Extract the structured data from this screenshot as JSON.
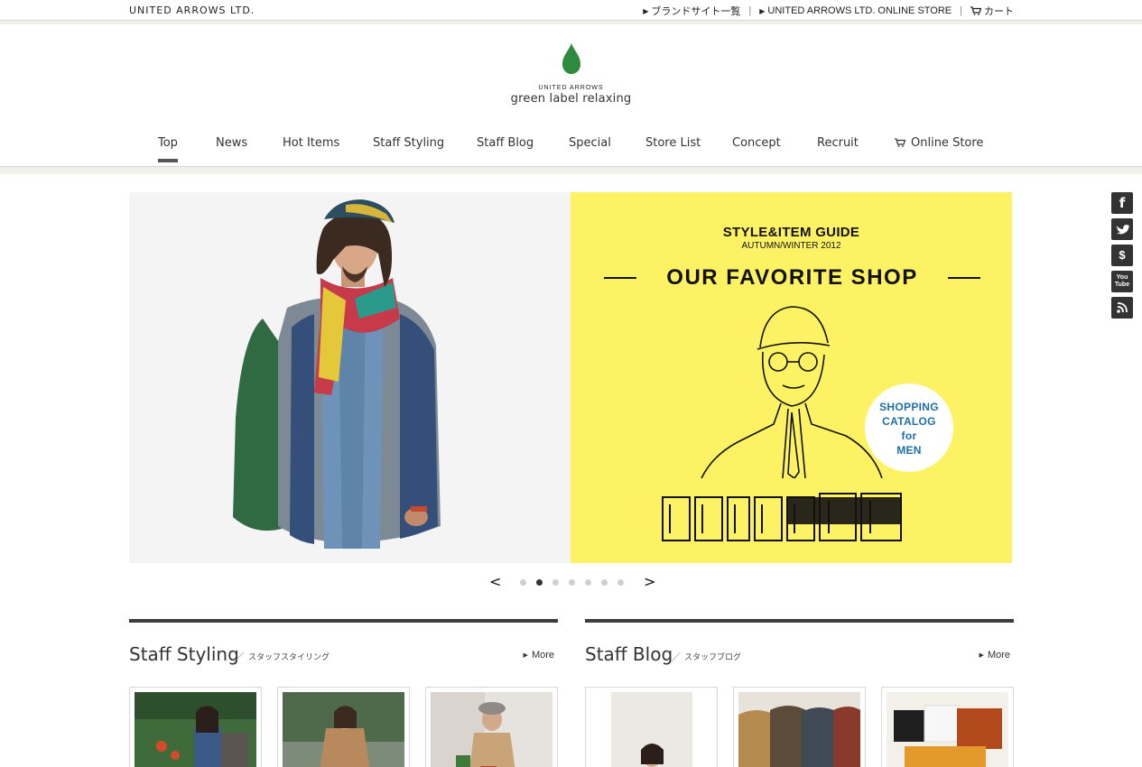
{
  "utility": {
    "corp_name": "UNITED ARROWS LTD.",
    "links": [
      {
        "label": "ブランドサイト一覧"
      },
      {
        "label": "UNITED ARROWS LTD. ONLINE STORE"
      }
    ],
    "cart_label": "カート"
  },
  "logo": {
    "brand_top": "UNITED ARROWS",
    "brand_name": "green label relaxing",
    "leaf_color": "#2e8b3e"
  },
  "nav": {
    "items": [
      {
        "label": "Top",
        "active": true
      },
      {
        "label": "News"
      },
      {
        "label": "Hot Items"
      },
      {
        "label": "Staff Styling"
      },
      {
        "label": "Staff Blog"
      },
      {
        "label": "Special"
      },
      {
        "label": "Store List"
      },
      {
        "label": "Concept"
      },
      {
        "label": "Recruit"
      },
      {
        "label": "Online Store"
      }
    ]
  },
  "hero": {
    "guide_title": "STYLE&ITEM GUIDE",
    "season": "AUTUMN/WINTER 2012",
    "headline": "OUR FAVORITE SHOP",
    "badge_lines": [
      "SHOPPING",
      "CATALOG",
      "for",
      "MEN"
    ],
    "lettering": "COLOR ME UP!",
    "bg_color": "#fdf263"
  },
  "pager": {
    "prev": "<",
    "next": ">",
    "slide_count": 7,
    "current_slide": 2
  },
  "sections": {
    "styling": {
      "title": "Staff Styling",
      "slash": "／",
      "subtitle": "スタッフスタイリング",
      "more": "More"
    },
    "blog": {
      "title": "Staff Blog",
      "slash": "／",
      "subtitle": "スタッフブログ",
      "more": "More"
    }
  },
  "social": {
    "icons": [
      "facebook-icon",
      "twitter-icon",
      "stylehint-icon",
      "youtube-icon",
      "rss-icon"
    ],
    "facebook_glyph": "f",
    "stylehint_glyph": "$",
    "youtube_glyph_top": "You",
    "youtube_glyph_bottom": "Tube"
  }
}
